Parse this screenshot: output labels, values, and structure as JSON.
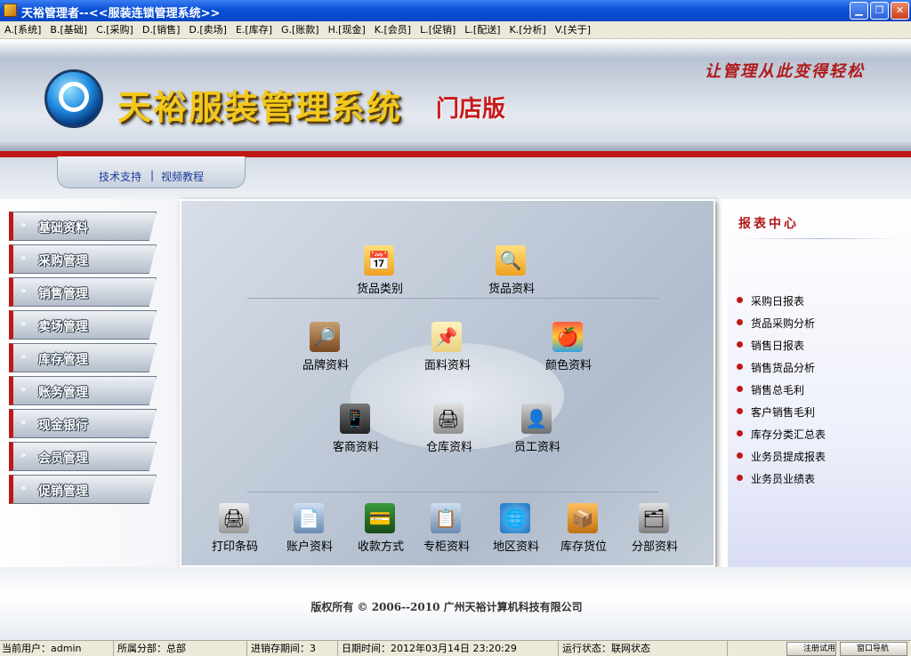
{
  "window": {
    "title": "天裕管理者--<<服装连锁管理系统>>"
  },
  "menubar": [
    "A.[系统]",
    "B.[基础]",
    "C.[采购]",
    "D.[销售]",
    "D.[卖场]",
    "E.[库存]",
    "G.[账款]",
    "H.[现金]",
    "K.[会员]",
    "L.[促销]",
    "L.[配送]",
    "K.[分析]",
    "V.[关于]"
  ],
  "header": {
    "system_title": "天裕服装管理系统",
    "edition": "门店版",
    "slogan": "让管理从此变得轻松",
    "tech_support": "技术支持",
    "separator": "|",
    "video_tutorial": "视频教程"
  },
  "nav": [
    "基础资料",
    "采购管理",
    "销售管理",
    "卖场管理",
    "库存管理",
    "账务管理",
    "现金银行",
    "会员管理",
    "促销管理"
  ],
  "main": {
    "row1": [
      {
        "label": "货品类别",
        "icon": "calendar-folder-icon"
      },
      {
        "label": "货品资料",
        "icon": "search-folder-icon"
      }
    ],
    "row2": [
      {
        "label": "品牌资料",
        "icon": "brand-magnifier-icon"
      },
      {
        "label": "面料资料",
        "icon": "fabric-note-icon"
      },
      {
        "label": "颜色资料",
        "icon": "apple-color-icon"
      }
    ],
    "row3": [
      {
        "label": "客商资料",
        "icon": "phone-modem-icon"
      },
      {
        "label": "仓库资料",
        "icon": "warehouse-printer-icon"
      },
      {
        "label": "员工资料",
        "icon": "employee-doc-icon"
      }
    ],
    "row4": [
      {
        "label": "打印条码",
        "icon": "printer-icon"
      },
      {
        "label": "账户资料",
        "icon": "account-doc-icon"
      },
      {
        "label": "收款方式",
        "icon": "payment-board-icon"
      },
      {
        "label": "专柜资料",
        "icon": "counter-doc-icon"
      },
      {
        "label": "地区资料",
        "icon": "globe-icon"
      },
      {
        "label": "库存货位",
        "icon": "storage-box-icon"
      },
      {
        "label": "分部资料",
        "icon": "branch-doc-icon"
      }
    ]
  },
  "reports": {
    "title": "报表中心",
    "items": [
      "采购日报表",
      "货品采购分析",
      "销售日报表",
      "销售货品分析",
      "销售总毛利",
      "客户销售毛利",
      "库存分类汇总表",
      "业务员提成报表",
      "业务员业绩表"
    ]
  },
  "footer": {
    "copyright": "版权所有 © 2006--2010 广州天裕计算机科技有限公司"
  },
  "status": {
    "user": "当前用户：admin",
    "branch": "所属分部：总部",
    "period": "进销存期间：3",
    "datetime": "日期时间：2012年03月14日 23:20:29",
    "state": "运行状态：联网状态",
    "btn1": "注册试用",
    "btn2": "窗口导航"
  },
  "colors": {
    "accent_red": "#c01818",
    "title_gold": "#f2c81c",
    "xp_blue": "#0a50d8"
  }
}
